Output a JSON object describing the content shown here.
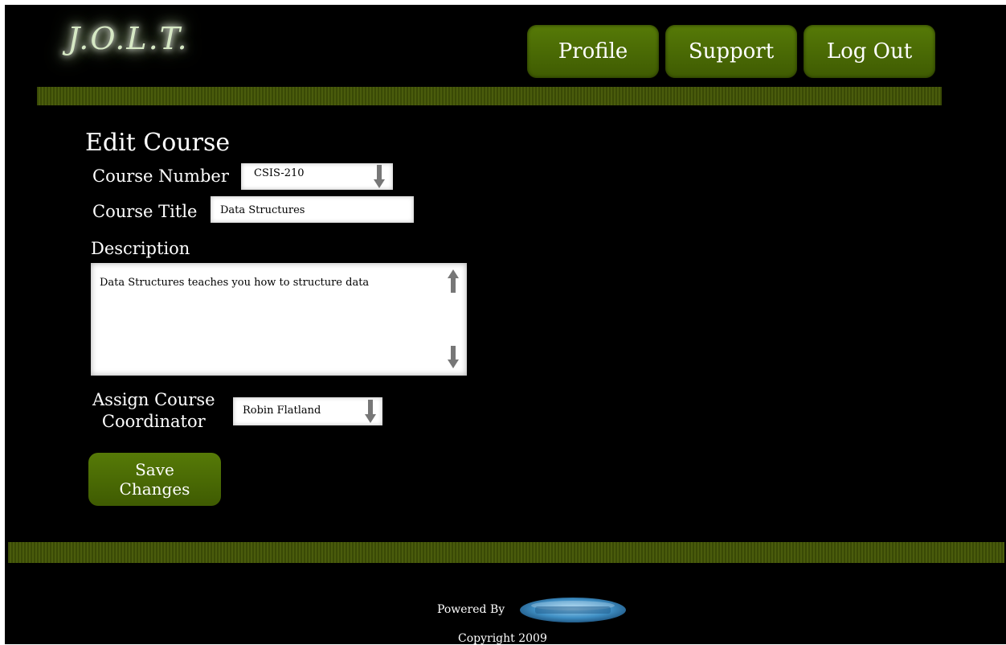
{
  "header": {
    "logo_text": "J.O.L.T.",
    "nav": {
      "profile": "Profile",
      "support": "Support",
      "logout": "Log Out"
    }
  },
  "form": {
    "title": "Edit Course",
    "course_number": {
      "label": "Course Number",
      "value": "CSIS-210"
    },
    "course_title": {
      "label": "Course Title",
      "value": "Data Structures"
    },
    "description": {
      "label": "Description",
      "value": "Data Structures teaches you how to structure data"
    },
    "coordinator": {
      "label_line1": "Assign Course",
      "label_line2": "Coordinator",
      "value": "Robin Flatland"
    },
    "save_button": {
      "line1": "Save",
      "line2": "Changes"
    }
  },
  "footer": {
    "powered_by": "Powered By",
    "copyright": "Copyright 2009"
  },
  "colors": {
    "background": "#000000",
    "button_green": "#4b6b04",
    "bar_green": "#3f5008",
    "text": "#ffffff"
  }
}
